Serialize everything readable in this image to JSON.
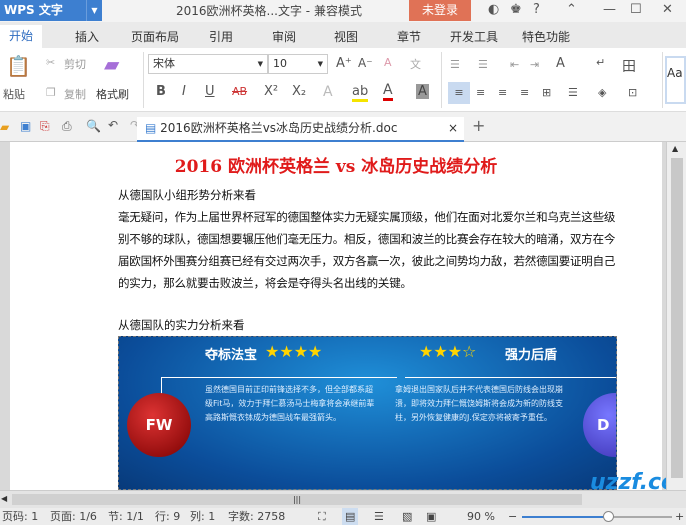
{
  "app": {
    "name": "WPS 文字",
    "window_title": "2016欧洲杯英格...文字 - 兼容模式",
    "login": "未登录",
    "help": "?"
  },
  "menu": {
    "tabs": [
      "开始",
      "插入",
      "页面布局",
      "引用",
      "审阅",
      "视图",
      "章节",
      "开发工具",
      "特色功能"
    ]
  },
  "ribbon": {
    "paste": "粘贴",
    "cut": "剪切",
    "copy": "复制",
    "format_painter": "格式刷",
    "font": "宋体",
    "size": "10",
    "bold": "B",
    "italic": "I",
    "underline": "U",
    "strike": "AB",
    "sup": "X²",
    "sub": "X₂",
    "font_color": "A",
    "style_preview": "Aa"
  },
  "doc_tab": {
    "name": "2016欧洲杯英格兰vs冰岛历史战绩分析.doc"
  },
  "document": {
    "title": "2016 欧洲杯英格兰 vs 冰岛历史战绩分析",
    "section1": "从德国队小组形势分析来看",
    "para1": "毫无疑问，作为上届世界杯冠军的德国整体实力无疑实属顶级，他们在面对北爱尔兰和乌克兰这些级别不够的球队，德国想要辗压他们毫无压力。相反，德国和波兰的比赛会存在较大的暗涌，双方在今届欧国杯外围赛分组赛已经有交过两次手，双方各赢一次，彼此之间势均力敌，若然德国要证明自己的实力，那么就要击败波兰，将会是夺得头名出线的关键。",
    "section2": "从德国队的实力分析来看",
    "image": {
      "left_heading": "夺标法宝",
      "left_stars": "★★★★",
      "right_stars": "★★★☆",
      "right_heading": "强力后盾",
      "left_ball": "FW",
      "right_ball": "D",
      "left_text": "虽然德国目前正印前锋选择不多，但全部都系超级Fit马，效力于拜仁慕汤马士梅拿将会承继前辈高路斯慨衣钵成为德国战车最强箭头。",
      "right_text": "拿姆退出国家队后并不代表德国后防线会出现崩溃，即将效力拜仁慨饶姆斯将会成为新的防线支柱，另外恢复健康的J.保定亦将被寄予重任。"
    }
  },
  "watermark": "uzzf.com",
  "status": {
    "page_num": "页码: 1",
    "pages": "页面: 1/6",
    "section": "节: 1/1",
    "row": "行: 9",
    "col": "列: 1",
    "words": "字数: 2758",
    "zoom": "90 %"
  },
  "zoom_level": 90
}
